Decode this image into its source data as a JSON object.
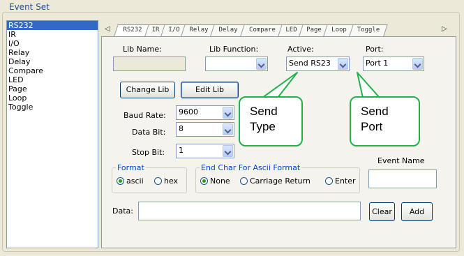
{
  "group": {
    "title": "Event Set"
  },
  "event_list": {
    "items": [
      "RS232",
      "IR",
      "I/O",
      "Relay",
      "Delay",
      "Compare",
      "LED",
      "Page",
      "Loop",
      "Toggle"
    ],
    "selected": "RS232"
  },
  "tabs": {
    "left_arrow": "◁",
    "right_arrow": "▷",
    "items": [
      "RS232",
      "IR",
      "I/O",
      "Relay",
      "Delay",
      "Compare",
      "LED",
      "Page",
      "Loop",
      "Toggle"
    ],
    "active": "RS232"
  },
  "form": {
    "lib_name_label": "Lib Name:",
    "lib_name_value": "",
    "lib_function_label": "Lib Function:",
    "lib_function_value": "",
    "active_label": "Active:",
    "active_value": "Send RS23",
    "port_label": "Port:",
    "port_value": "Port 1",
    "change_lib_button": "Change Lib",
    "edit_lib_button": "Edit Lib",
    "baud_rate_label": "Baud Rate:",
    "baud_rate_value": "9600",
    "data_bit_label": "Data Bit:",
    "data_bit_value": "8",
    "stop_bit_label": "Stop Bit:",
    "stop_bit_value": "1",
    "format_legend": "Format",
    "format_ascii": "ascii",
    "format_hex": "hex",
    "format_selected": "ascii",
    "end_char_legend": "End Char For Ascii Format",
    "end_none": "None",
    "end_cr": "Carriage Return",
    "end_enter": "Enter",
    "end_selected": "None",
    "event_name_label": "Event Name",
    "event_name_value": "",
    "data_label": "Data:",
    "data_value": "",
    "clear_button": "Clear",
    "add_button": "Add"
  },
  "callouts": {
    "send_type": [
      "Send",
      "Type"
    ],
    "send_port": [
      "Send",
      "Port"
    ]
  },
  "colors": {
    "callout_border": "#22b24c",
    "selection": "#316ac5",
    "group_title": "#1f4fa0"
  }
}
